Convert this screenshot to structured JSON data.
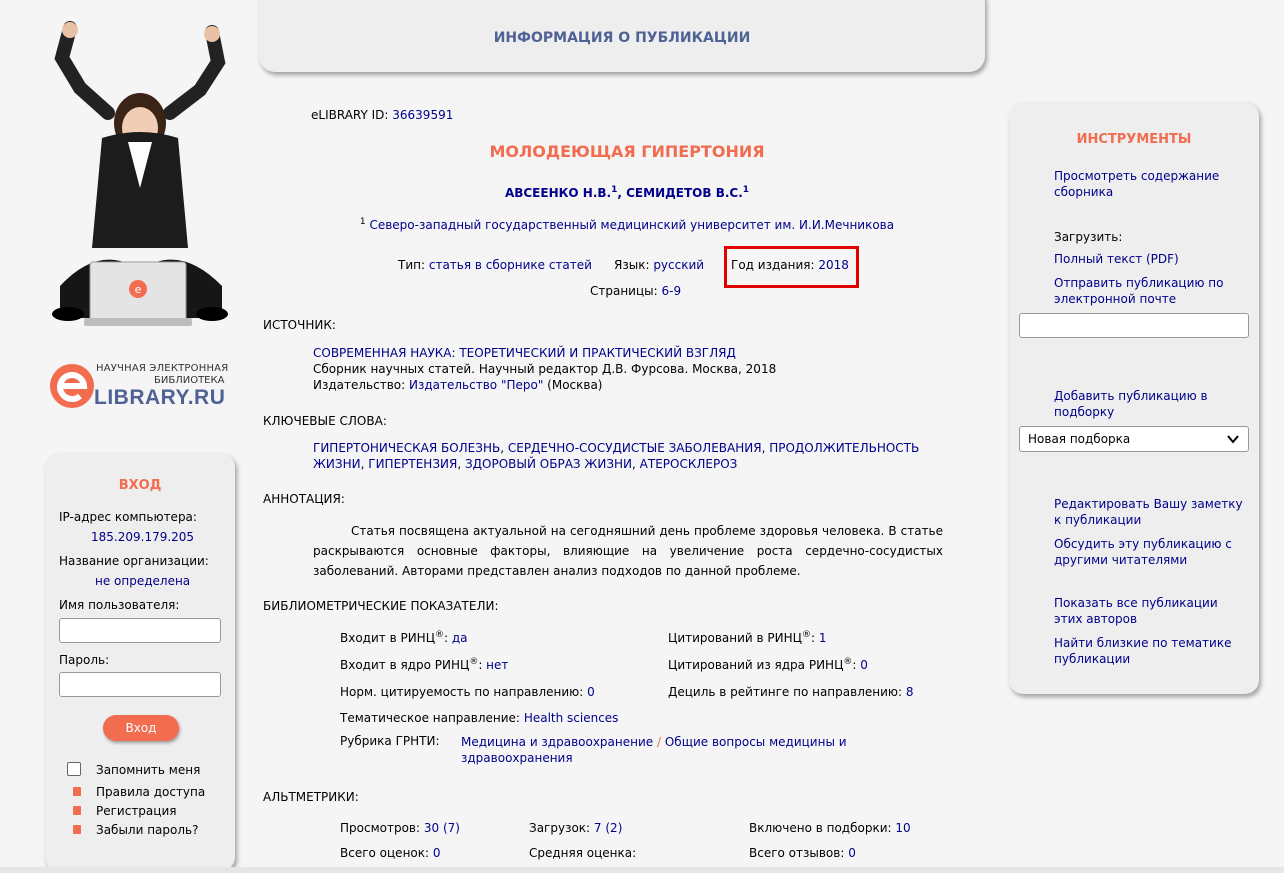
{
  "header": {
    "title": "ИНФОРМАЦИЯ О ПУБЛИКАЦИИ"
  },
  "logo": {
    "line1": "НАУЧНАЯ ЭЛЕКТРОННАЯ",
    "line2": "БИБЛИОТЕКА",
    "brand": "LIBRARY.RU",
    "letter": "e"
  },
  "login": {
    "title": "ВХОД",
    "ip_label": "IP-адрес компьютера:",
    "ip_value": "185.209.179.205",
    "org_label": "Название организации:",
    "org_value": "не определена",
    "user_label": "Имя пользователя:",
    "pass_label": "Пароль:",
    "button": "Вход",
    "remember": "Запомнить меня",
    "links": [
      "Правила доступа",
      "Регистрация",
      "Забыли пароль?"
    ]
  },
  "pub": {
    "id_label": "eLIBRARY ID:",
    "id": "36639591",
    "title": "МОЛОДЕЮЩАЯ ГИПЕРТОНИЯ",
    "author1": "АВСЕЕНКО Н.В.",
    "author2": "СЕМИДЕТОВ В.С.",
    "sup": "1",
    "affiliation": "Северо-западный государственный медицинский университет им. И.И.Мечникова",
    "type_label": "Тип:",
    "type": "статья в сборнике статей",
    "lang_label": "Язык:",
    "lang": "русский",
    "year_label": "Год издания:",
    "year": "2018",
    "pages_label": "Страницы:",
    "pages": "6-9"
  },
  "source": {
    "heading": "ИСТОЧНИК:",
    "title": "СОВРЕМЕННАЯ НАУКА: ТЕОРЕТИЧЕСКИЙ И ПРАКТИЧЕСКИЙ ВЗГЛЯД",
    "desc": "Сборник научных статей. Научный редактор Д.В. Фурсова. Москва, 2018",
    "publisher_label": "Издательство:",
    "publisher": "Издательство \"Перо\"",
    "city": " (Москва)"
  },
  "keywords": {
    "heading": "КЛЮЧЕВЫЕ СЛОВА:",
    "items": [
      "ГИПЕРТОНИЧЕСКАЯ БОЛЕЗНЬ",
      "СЕРДЕЧНО-СОСУДИСТЫЕ ЗАБОЛЕВАНИЯ",
      "ПРОДОЛЖИТЕЛЬНОСТЬ ЖИЗНИ",
      "ГИПЕРТЕНЗИЯ",
      "ЗДОРОВЫЙ ОБРАЗ ЖИЗНИ",
      "АТЕРОСКЛЕРОЗ"
    ]
  },
  "annotation": {
    "heading": "АННОТАЦИЯ:",
    "text": "Статья посвящена актуальной на сегодняшний день проблеме здоровья человека. В статье раскрываются основные факторы, влияющие на увеличение роста сердечно-сосудистых заболеваний. Авторами представлен анализ подходов по данной проблеме."
  },
  "biblio": {
    "heading": "БИБЛИОМЕТРИЧЕСКИЕ ПОКАЗАТЕЛИ:",
    "rinc_label": "Входит в РИНЦ",
    "rinc": "да",
    "core_label": "Входит в ядро РИНЦ",
    "core": "нет",
    "norm_label": "Норм. цитируемость по направлению:",
    "norm": "0",
    "cit_label": "Цитирований в РИНЦ",
    "cit": "1",
    "cit_core_label": "Цитирований из ядра РИНЦ",
    "cit_core": "0",
    "decile_label": "Дециль в рейтинге по направлению:",
    "decile": "8",
    "reg": "®",
    "topic_label": "Тематическое направление:",
    "topic": "Health sciences",
    "grnti_label": "Рубрика ГРНТИ:",
    "grnti1": "Медицина и здравоохранение",
    "grnti_sep": " / ",
    "grnti2": "Общие вопросы медицины и здравоохранения"
  },
  "alt": {
    "heading": "АЛЬТМЕТРИКИ:",
    "views_label": "Просмотров:",
    "views": "30 (7)",
    "downloads_label": "Загрузок:",
    "downloads": "7 (2)",
    "collections_label": "Включено в подборки:",
    "collections": "10",
    "ratings_label": "Всего оценок:",
    "ratings": "0",
    "avg_label": "Средняя оценка:",
    "avg": "",
    "reviews_label": "Всего отзывов:",
    "reviews": "0"
  },
  "tools": {
    "title": "ИНСТРУМЕНТЫ",
    "view_contents": "Просмотреть содержание сборника",
    "download_label": "Загрузить:",
    "full_text": "Полный текст (PDF)",
    "send_email": "Отправить публикацию по электронной почте",
    "add_collection": "Добавить публикацию в подборку",
    "select_value": "Новая подборка",
    "edit_note": "Редактировать Вашу заметку к публикации",
    "discuss": "Обсудить эту публикацию с другими читателями",
    "show_all": "Показать все публикации этих авторов",
    "find_similar": "Найти близкие по тематике публикации"
  },
  "colors": {
    "accent": "#f26c4f",
    "link": "#00008b",
    "header": "#4f6296",
    "highlight": "#e00000",
    "panel": "#eeeeee"
  }
}
